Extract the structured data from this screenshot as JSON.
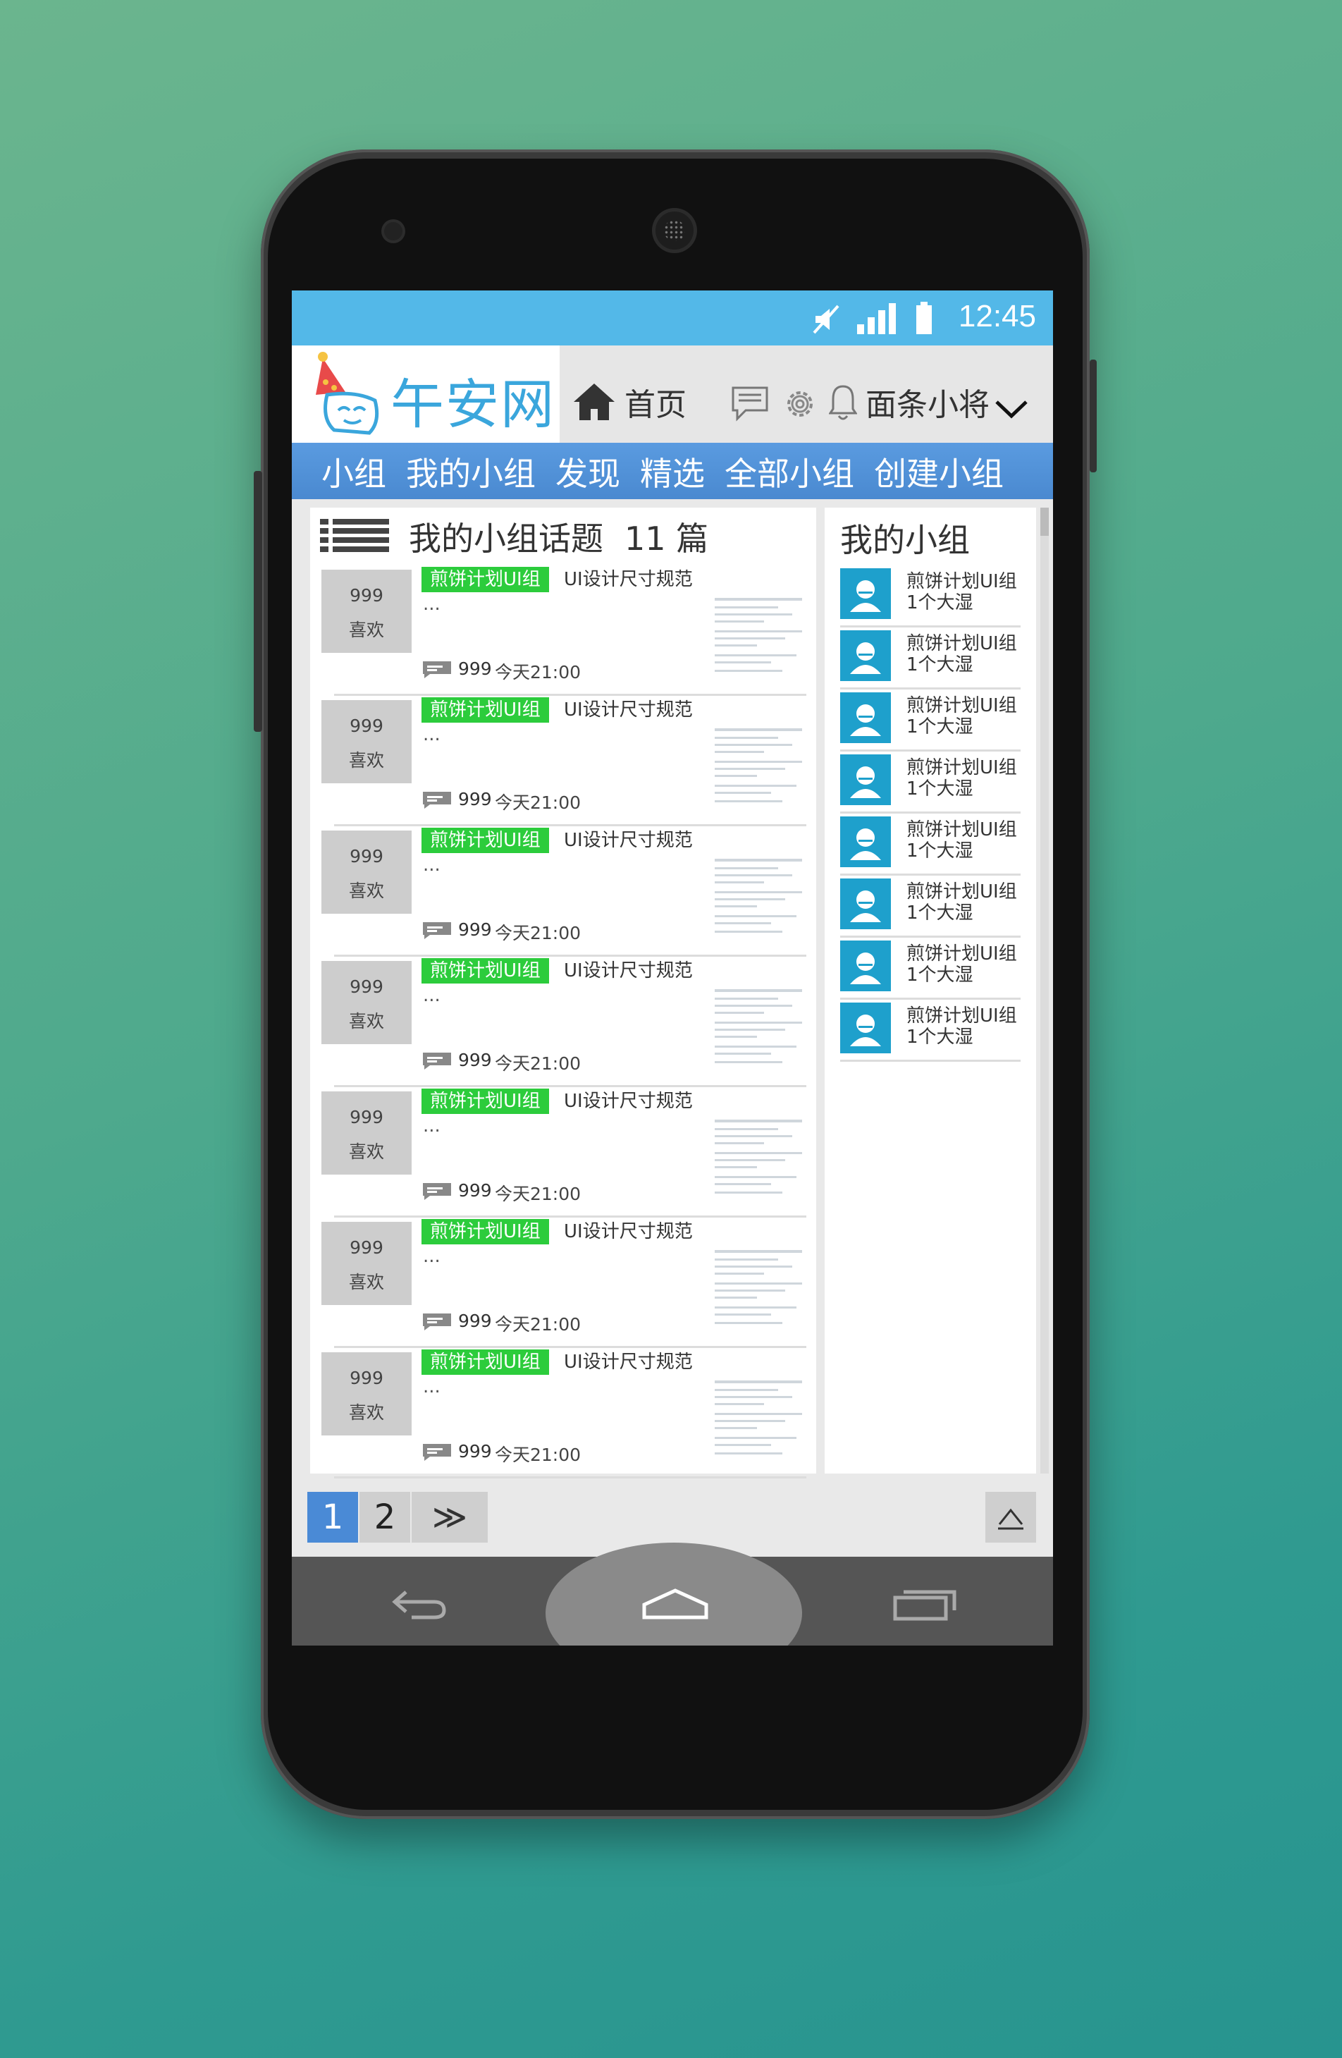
{
  "status": {
    "time": "12:45"
  },
  "header": {
    "logo_text": "午安网",
    "home_label": "首页",
    "user_name": "面条小将"
  },
  "nav": {
    "items": [
      "小组",
      "我的小组",
      "发现",
      "精选",
      "全部小组",
      "创建小组"
    ]
  },
  "main": {
    "title": "我的小组话题",
    "count": "11 篇",
    "topics": [
      {
        "likes": "999",
        "likes_label": "喜欢",
        "tag": "煎饼计划UI组",
        "title": "UI设计尺寸规范",
        "excerpt": "...",
        "comments": "999",
        "time": "今天21:00"
      },
      {
        "likes": "999",
        "likes_label": "喜欢",
        "tag": "煎饼计划UI组",
        "title": "UI设计尺寸规范",
        "excerpt": "...",
        "comments": "999",
        "time": "今天21:00"
      },
      {
        "likes": "999",
        "likes_label": "喜欢",
        "tag": "煎饼计划UI组",
        "title": "UI设计尺寸规范",
        "excerpt": "...",
        "comments": "999",
        "time": "今天21:00"
      },
      {
        "likes": "999",
        "likes_label": "喜欢",
        "tag": "煎饼计划UI组",
        "title": "UI设计尺寸规范",
        "excerpt": "...",
        "comments": "999",
        "time": "今天21:00"
      },
      {
        "likes": "999",
        "likes_label": "喜欢",
        "tag": "煎饼计划UI组",
        "title": "UI设计尺寸规范",
        "excerpt": "...",
        "comments": "999",
        "time": "今天21:00"
      },
      {
        "likes": "999",
        "likes_label": "喜欢",
        "tag": "煎饼计划UI组",
        "title": "UI设计尺寸规范",
        "excerpt": "...",
        "comments": "999",
        "time": "今天21:00"
      },
      {
        "likes": "999",
        "likes_label": "喜欢",
        "tag": "煎饼计划UI组",
        "title": "UI设计尺寸规范",
        "excerpt": "...",
        "comments": "999",
        "time": "今天21:00"
      }
    ]
  },
  "sidebar": {
    "title": "我的小组",
    "groups": [
      {
        "name": "煎饼计划UI组",
        "sub": "1个大湿"
      },
      {
        "name": "煎饼计划UI组",
        "sub": "1个大湿"
      },
      {
        "name": "煎饼计划UI组",
        "sub": "1个大湿"
      },
      {
        "name": "煎饼计划UI组",
        "sub": "1个大湿"
      },
      {
        "name": "煎饼计划UI组",
        "sub": "1个大湿"
      },
      {
        "name": "煎饼计划UI组",
        "sub": "1个大湿"
      },
      {
        "name": "煎饼计划UI组",
        "sub": "1个大湿"
      },
      {
        "name": "煎饼计划UI组",
        "sub": "1个大湿"
      }
    ]
  },
  "pagination": {
    "page1": "1",
    "page2": "2",
    "next": "≫"
  },
  "colors": {
    "status_bar": "#53b8e8",
    "nav_bar": "#4a89d0",
    "tag": "#2ccc3c",
    "avatar": "#1ea0cc",
    "active_page": "#4a8ad6"
  },
  "icons": [
    "mute-icon",
    "signal-icon",
    "battery-icon",
    "home-icon",
    "chat-icon",
    "gear-icon",
    "bell-icon",
    "chevron-down-icon",
    "list-icon",
    "comment-icon",
    "user-avatar-icon",
    "back-to-top-icon",
    "back-icon",
    "android-home-icon",
    "recents-icon"
  ]
}
